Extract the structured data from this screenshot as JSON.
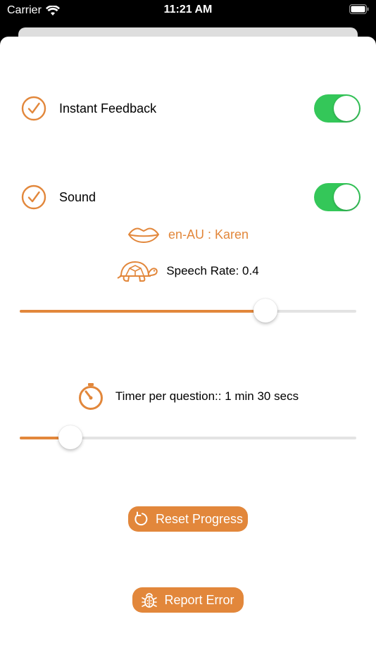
{
  "status_bar": {
    "carrier": "Carrier",
    "time": "11:21 AM"
  },
  "settings": {
    "instant_feedback": {
      "label": "Instant Feedback",
      "enabled": true
    },
    "sound": {
      "label": "Sound",
      "enabled": true
    }
  },
  "voice": {
    "label": "en-AU : Karen"
  },
  "speech_rate": {
    "label": "Speech Rate: 0.4",
    "slider_fraction": 0.73
  },
  "timer": {
    "label": "Timer per question:: 1 min 30 secs",
    "slider_fraction": 0.15
  },
  "buttons": {
    "reset_label": "Reset Progress",
    "report_label": "Report Error"
  },
  "colors": {
    "accent": "#e2873b",
    "toggle_on": "#34c759",
    "track": "#e3e3e3"
  },
  "icons": {
    "check": "check-circle-icon",
    "voice": "lips-icon",
    "rate": "turtle-icon",
    "timer": "stopwatch-icon",
    "reset": "refresh-icon",
    "report": "bug-icon"
  }
}
